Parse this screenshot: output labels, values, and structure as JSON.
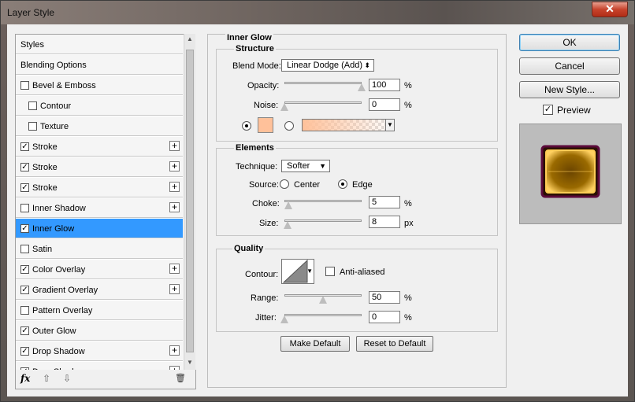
{
  "window": {
    "title": "Layer Style",
    "close_icon": "✕"
  },
  "styles_list": {
    "items": [
      {
        "label": "Styles",
        "checkbox": false,
        "checked": false,
        "indent": 0,
        "plus": false,
        "selected": false
      },
      {
        "label": "Blending Options",
        "checkbox": false,
        "checked": false,
        "indent": 0,
        "plus": false,
        "selected": false
      },
      {
        "label": "Bevel & Emboss",
        "checkbox": true,
        "checked": false,
        "indent": 0,
        "plus": false,
        "selected": false
      },
      {
        "label": "Contour",
        "checkbox": true,
        "checked": false,
        "indent": 1,
        "plus": false,
        "selected": false
      },
      {
        "label": "Texture",
        "checkbox": true,
        "checked": false,
        "indent": 1,
        "plus": false,
        "selected": false
      },
      {
        "label": "Stroke",
        "checkbox": true,
        "checked": true,
        "indent": 0,
        "plus": true,
        "selected": false
      },
      {
        "label": "Stroke",
        "checkbox": true,
        "checked": true,
        "indent": 0,
        "plus": true,
        "selected": false
      },
      {
        "label": "Stroke",
        "checkbox": true,
        "checked": true,
        "indent": 0,
        "plus": true,
        "selected": false
      },
      {
        "label": "Inner Shadow",
        "checkbox": true,
        "checked": false,
        "indent": 0,
        "plus": true,
        "selected": false
      },
      {
        "label": "Inner Glow",
        "checkbox": true,
        "checked": true,
        "indent": 0,
        "plus": false,
        "selected": true
      },
      {
        "label": "Satin",
        "checkbox": true,
        "checked": false,
        "indent": 0,
        "plus": false,
        "selected": false
      },
      {
        "label": "Color Overlay",
        "checkbox": true,
        "checked": true,
        "indent": 0,
        "plus": true,
        "selected": false
      },
      {
        "label": "Gradient Overlay",
        "checkbox": true,
        "checked": true,
        "indent": 0,
        "plus": true,
        "selected": false
      },
      {
        "label": "Pattern Overlay",
        "checkbox": true,
        "checked": false,
        "indent": 0,
        "plus": false,
        "selected": false
      },
      {
        "label": "Outer Glow",
        "checkbox": true,
        "checked": true,
        "indent": 0,
        "plus": false,
        "selected": false
      },
      {
        "label": "Drop Shadow",
        "checkbox": true,
        "checked": true,
        "indent": 0,
        "plus": true,
        "selected": false
      },
      {
        "label": "Drop Shadow",
        "checkbox": true,
        "checked": true,
        "indent": 0,
        "plus": true,
        "selected": false
      }
    ],
    "footer": {
      "fx": "fx",
      "up_icon": "⇧",
      "down_icon": "⇩",
      "trash_icon": "🗑"
    }
  },
  "inner_glow": {
    "title": "Inner Glow",
    "structure": {
      "title": "Structure",
      "blend_mode_label": "Blend Mode:",
      "blend_mode_value": "Linear Dodge (Add)",
      "opacity_label": "Opacity:",
      "opacity_value": "100",
      "opacity_fraction": 1.0,
      "noise_label": "Noise:",
      "noise_value": "0",
      "noise_fraction": 0.0,
      "unit": "%",
      "color_swatch": "#ffc19a"
    },
    "elements": {
      "title": "Elements",
      "technique_label": "Technique:",
      "technique_value": "Softer",
      "source_label": "Source:",
      "center_label": "Center",
      "edge_label": "Edge",
      "choke_label": "Choke:",
      "choke_value": "5",
      "choke_fraction": 0.05,
      "size_label": "Size:",
      "size_value": "8",
      "size_fraction": 0.04,
      "choke_unit": "%",
      "size_unit": "px"
    },
    "quality": {
      "title": "Quality",
      "contour_label": "Contour:",
      "antialiased_label": "Anti-aliased",
      "range_label": "Range:",
      "range_value": "50",
      "range_fraction": 0.5,
      "jitter_label": "Jitter:",
      "jitter_value": "0",
      "jitter_fraction": 0.0,
      "unit": "%"
    },
    "make_default": "Make Default",
    "reset_default": "Reset to Default"
  },
  "actions": {
    "ok": "OK",
    "cancel": "Cancel",
    "new_style": "New Style...",
    "preview_label": "Preview",
    "preview_checked": true
  }
}
